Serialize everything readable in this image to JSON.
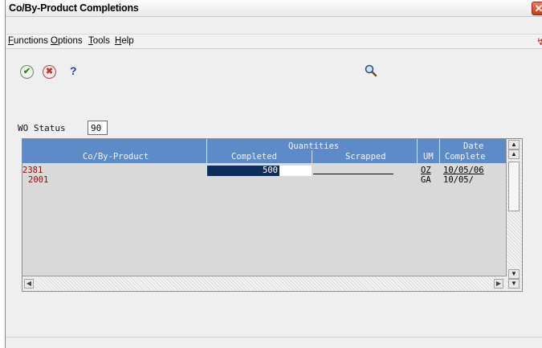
{
  "window": {
    "title": "Co/By-Product Completions"
  },
  "menu": [
    {
      "key": "F",
      "rest": "unctions"
    },
    {
      "key": "O",
      "rest": "ptions"
    },
    {
      "key": "T",
      "rest": "ools"
    },
    {
      "key": "H",
      "rest": "elp"
    }
  ],
  "toolbar": {
    "ok": "✔",
    "cancel": "✖",
    "help": "?"
  },
  "wo_status": {
    "label": "WO Status",
    "value": "90"
  },
  "grid": {
    "headers": {
      "co_by_product": "Co/By-Product",
      "quantities": "Quantities",
      "completed": "Completed",
      "scrapped": "Scrapped",
      "um": "UM",
      "date": "Date",
      "complete": "Complete"
    },
    "rows": [
      {
        "product": "2381",
        "completed": "500",
        "um": "OZ",
        "date": "10/05/06"
      },
      {
        "product": "2001",
        "completed": "",
        "um": "GA",
        "date": "10/05/"
      }
    ]
  }
}
